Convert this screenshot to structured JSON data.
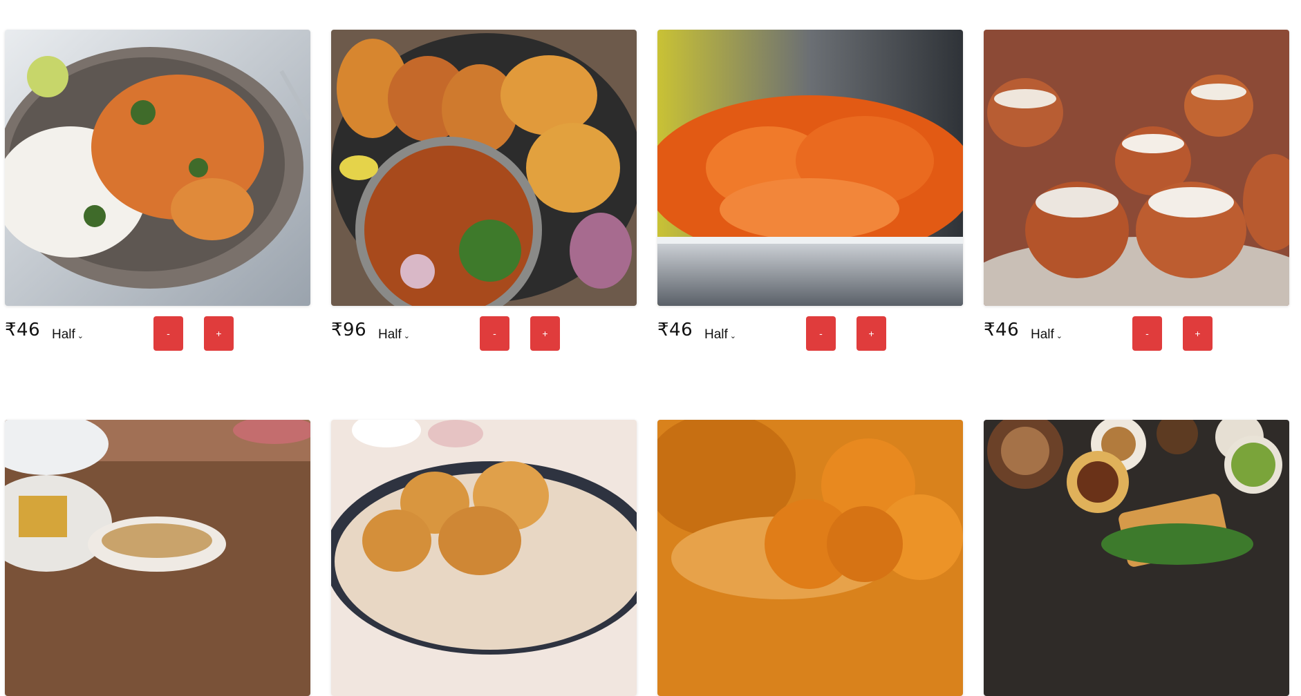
{
  "menu": {
    "items": [
      {
        "price": "₹46",
        "size": "Half",
        "minus_label": "-",
        "plus_label": "+",
        "image": "paneer-rice-bowl"
      },
      {
        "price": "₹96",
        "size": "Half",
        "minus_label": "-",
        "plus_label": "+",
        "image": "pav-bhaji-platter"
      },
      {
        "price": "₹46",
        "size": "Half",
        "minus_label": "-",
        "plus_label": "+",
        "image": "jalebi-plate"
      },
      {
        "price": "₹46",
        "size": "Half",
        "minus_label": "-",
        "plus_label": "+",
        "image": "kulhad-lassi"
      },
      {
        "image": "chai-with-snacks"
      },
      {
        "image": "pani-puri"
      },
      {
        "image": "besan-ladoo"
      },
      {
        "image": "dosa-thali"
      }
    ]
  },
  "colors": {
    "button": "#e03c3c",
    "background": "#ffffff"
  }
}
